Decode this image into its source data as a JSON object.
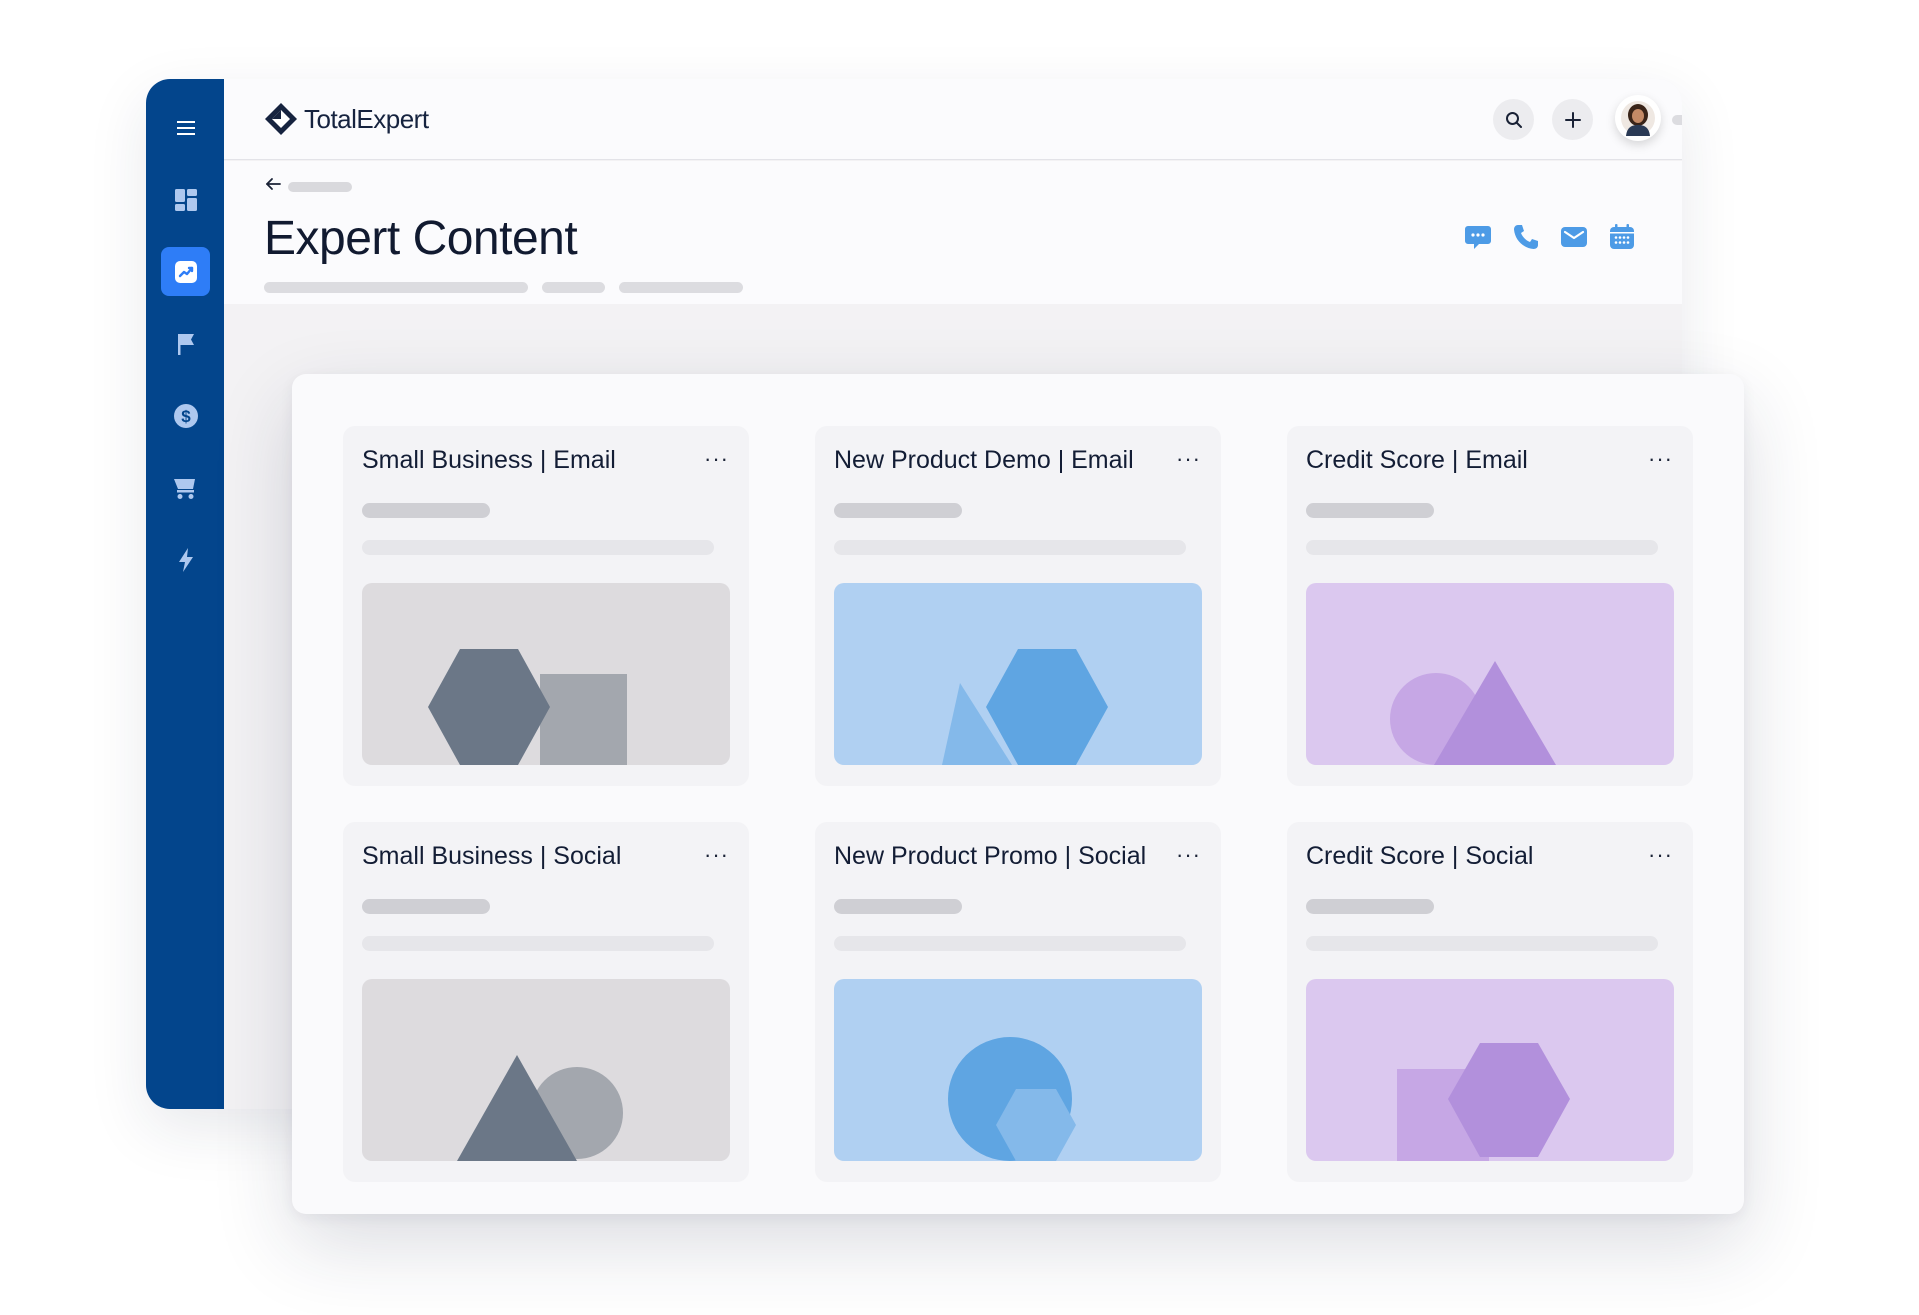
{
  "app": {
    "logo_text": "TotalExpert",
    "page_title": "Expert Content"
  },
  "sidebar": {
    "items": [
      {
        "icon": "menu-icon"
      },
      {
        "icon": "dashboard-icon"
      },
      {
        "icon": "trending-chart-icon",
        "active": true
      },
      {
        "icon": "flag-icon"
      },
      {
        "icon": "dollar-icon"
      },
      {
        "icon": "cart-icon"
      },
      {
        "icon": "lightning-icon"
      }
    ],
    "active_color": "#2e7df7",
    "background": "#03458c"
  },
  "topbar": {
    "buttons": [
      {
        "icon": "search-icon"
      },
      {
        "icon": "plus-icon"
      }
    ],
    "avatar": "user-avatar"
  },
  "actions": [
    {
      "icon": "chat-icon"
    },
    {
      "icon": "phone-icon"
    },
    {
      "icon": "mail-icon"
    },
    {
      "icon": "calendar-icon"
    }
  ],
  "accent": "#4d9be6",
  "cards": [
    {
      "title": "Small Business | Email",
      "menu": "···",
      "theme": "gray"
    },
    {
      "title": "New Product Demo | Email",
      "menu": "···",
      "theme": "blue"
    },
    {
      "title": "Credit Score | Email",
      "menu": "···",
      "theme": "purple"
    },
    {
      "title": "Small Business | Social",
      "menu": "···",
      "theme": "gray"
    },
    {
      "title": "New Product Promo | Social",
      "menu": "···",
      "theme": "blue"
    },
    {
      "title": "Credit Score | Social",
      "menu": "···",
      "theme": "purple"
    }
  ],
  "themes": {
    "gray": "#dddbde",
    "blue": "#b0d0f2",
    "purple": "#dbc8ef"
  }
}
